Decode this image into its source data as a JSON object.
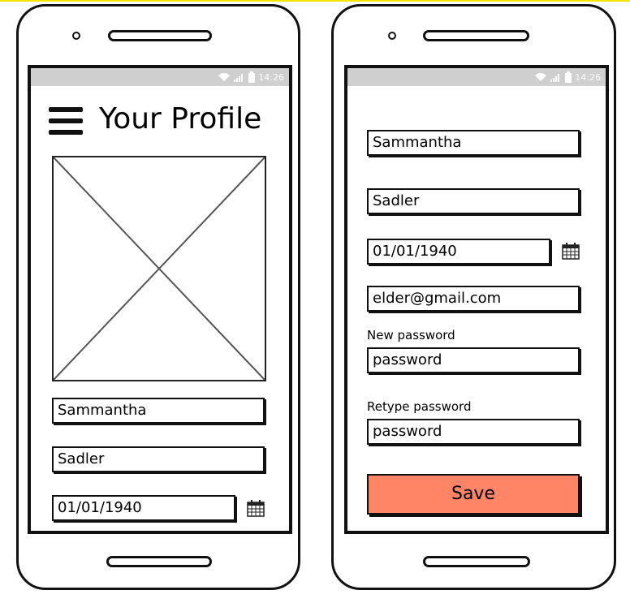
{
  "left_phone": {
    "status_time": "14:26",
    "title": "Your Profile",
    "first_name": "Sammantha",
    "last_name": "Sadler",
    "birthdate": "01/01/1940"
  },
  "right_phone": {
    "status_time": "14:26",
    "first_name": "Sammantha",
    "last_name": "Sadler",
    "birthdate": "01/01/1940",
    "email": "elder@gmail.com",
    "new_password_label": "New password",
    "new_password_value": "password",
    "retype_password_label": "Retype password",
    "retype_password_value": "password",
    "save_label": "Save"
  },
  "colors": {
    "save_button": "#ff8566",
    "status_bar": "#cfcfcf"
  },
  "icons": [
    "menu-icon",
    "calendar-icon",
    "wifi-icon",
    "signal-icon",
    "battery-icon"
  ]
}
